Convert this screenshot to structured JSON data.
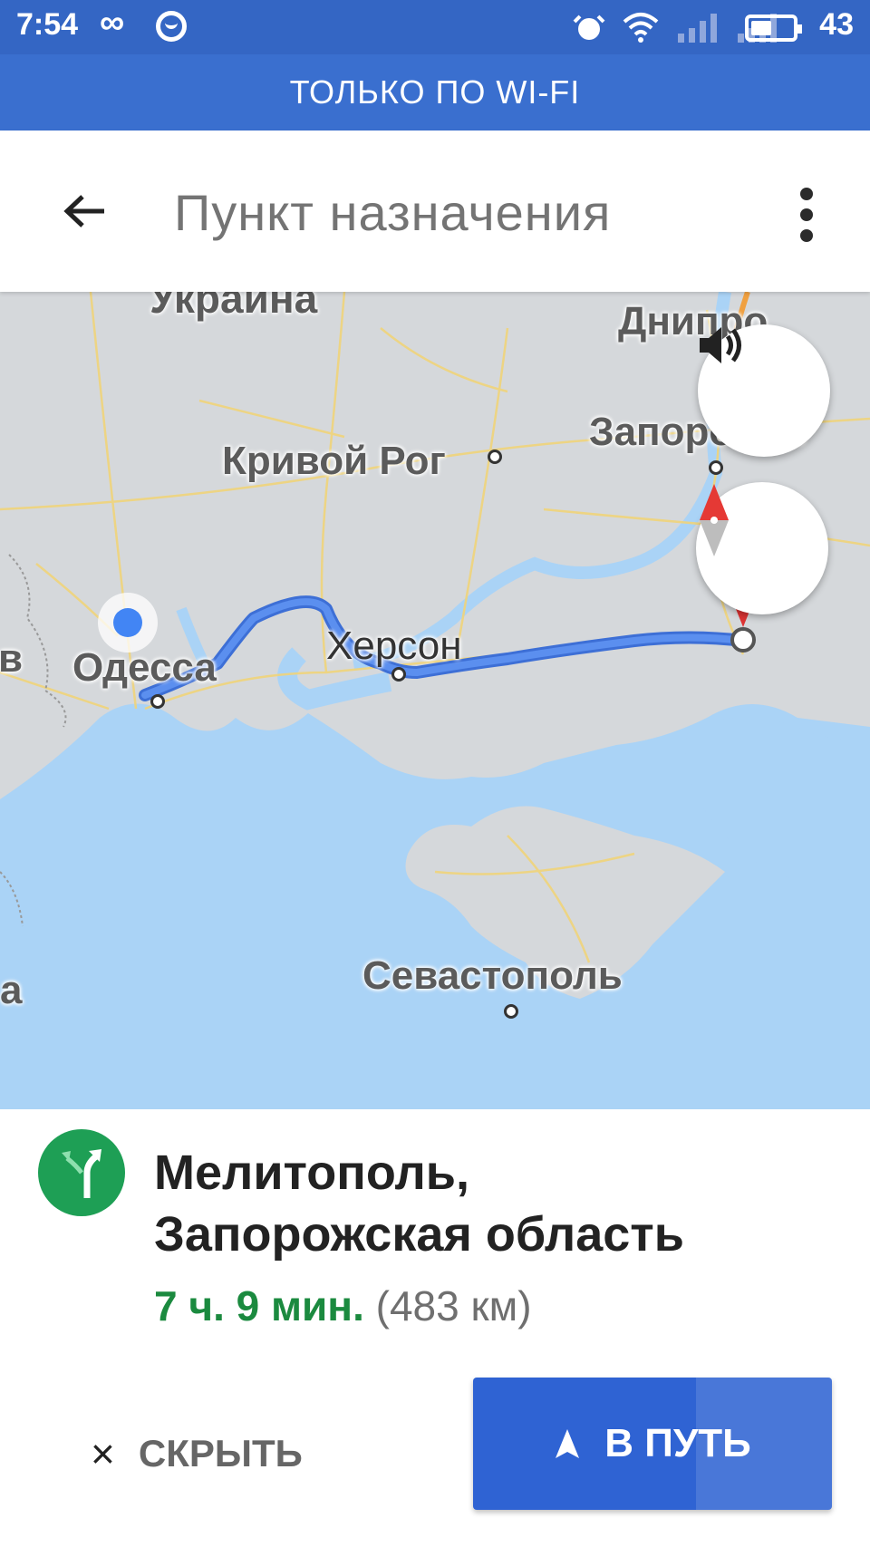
{
  "status_bar": {
    "time": "7:54",
    "loop_symbol": "∞",
    "battery": "43"
  },
  "banner": {
    "text": "ТОЛЬКО ПО WI-FI"
  },
  "search": {
    "placeholder": "Пункт назначения"
  },
  "map": {
    "labels": {
      "country": "Украина",
      "dnipro": "Днипро",
      "zaporozhye": "Запорожье",
      "krivoy_rog": "Кривой Рог",
      "kherson": "Херсон",
      "odessa": "Одесса",
      "sevastopol": "Севастополь",
      "edge_left": "в",
      "edge_bottom_left": "а"
    },
    "colors": {
      "land": "#d4d7da",
      "water": "#a9d2f7",
      "route": "#4a7fe0",
      "roads": "#f3d77a"
    }
  },
  "destination": {
    "line1": "Мелитополь,",
    "line2": "Запорожская область",
    "time": "7 ч. 9 мин.",
    "distance": "(483 км)"
  },
  "actions": {
    "hide_label": "СКРЫТЬ",
    "hide_icon": "×",
    "go_label": "В ПУТЬ"
  }
}
